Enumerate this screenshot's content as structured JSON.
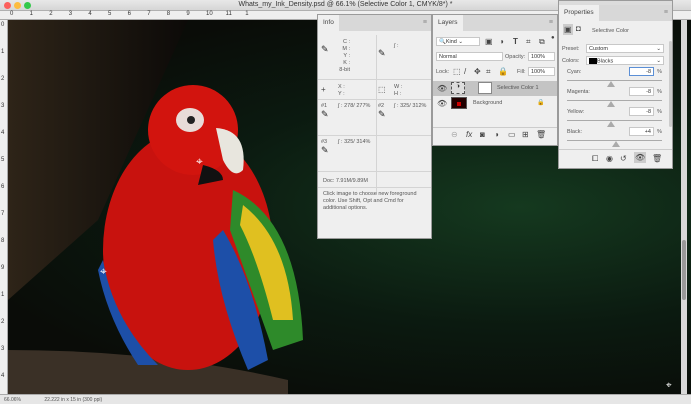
{
  "window": {
    "title": "Whats_my_Ink_Density.psd @ 66.1% (Selective Color 1, CMYK/8*) *"
  },
  "ruler": {
    "top": [
      "0",
      "1",
      "2",
      "3",
      "4",
      "5",
      "6",
      "7",
      "8",
      "9",
      "10",
      "11",
      "1"
    ],
    "left": [
      "0",
      "1",
      "2",
      "3",
      "4",
      "5",
      "6",
      "7",
      "8",
      "9",
      "1",
      "2",
      "3",
      "4"
    ]
  },
  "info": {
    "tab": "Info",
    "cmyk_labels": [
      "C :",
      "M :",
      "Y :",
      "K :"
    ],
    "bit": "8-bit",
    "xy": [
      "X :",
      "Y :"
    ],
    "wh": [
      "W :",
      "H :"
    ],
    "top_right": "∫ :",
    "s1_label": "#1",
    "s1": "∫ : 278/ 277%",
    "s2_label": "#2",
    "s2": "∫ : 325/ 312%",
    "s3_label": "#3",
    "s3": "∫ : 325/ 314%",
    "doc": "Doc: 7.91M/9.89M",
    "hint": "Click image to choose new foreground color.  Use Shift, Opt and Cmd for additional options."
  },
  "layers": {
    "tab": "Layers",
    "filter": "Kind",
    "blend": "Normal",
    "opacity_label": "Opacity:",
    "opacity": "100%",
    "lock_label": "Lock:",
    "fill_label": "Fill:",
    "fill": "100%",
    "items": [
      {
        "name": "Selective Color 1",
        "selected": true
      },
      {
        "name": "Background",
        "selected": false
      }
    ]
  },
  "properties": {
    "tab": "Properties",
    "type": "Selective Color",
    "preset_label": "Preset:",
    "preset": "Custom",
    "colors_label": "Colors:",
    "colors": "Blacks",
    "sliders": [
      {
        "label": "Cyan:",
        "value": "-8",
        "pct": -8
      },
      {
        "label": "Magenta:",
        "value": "-8",
        "pct": -8
      },
      {
        "label": "Yellow:",
        "value": "-8",
        "pct": -8
      },
      {
        "label": "Black:",
        "value": "+4",
        "pct": 4
      }
    ],
    "unit": "%"
  },
  "status": {
    "zoom": "66.06%",
    "doc": "22.222 in x 15 in (300 ppi)"
  }
}
